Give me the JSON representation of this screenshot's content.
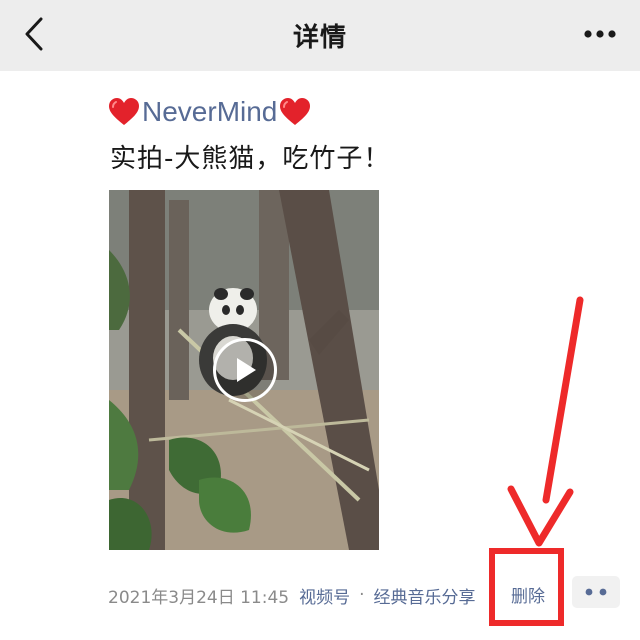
{
  "header": {
    "title": "详情",
    "back_icon": "chevron-left-icon",
    "more_icon": "more-dots-icon"
  },
  "post": {
    "author": "NeverMind",
    "author_emoji": "heart-icon",
    "text": "实拍-大熊猫，吃竹子！",
    "media": {
      "type": "video",
      "subject": "panda-eating-bamboo",
      "play_icon": "play-icon"
    },
    "meta": {
      "timestamp": "2021年3月24日 11:45",
      "channel": "视频号",
      "separator": "·",
      "music_tag": "经典音乐分享",
      "delete_label": "删除"
    },
    "comment_button_icon": "comment-dots-icon"
  },
  "annotation": {
    "color": "#ee2a2a",
    "target": "delete-link"
  },
  "colors": {
    "header_bg": "#ededed",
    "link": "#576b95",
    "meta_text": "#8a8a8a",
    "annotation_red": "#ee2a2a"
  }
}
